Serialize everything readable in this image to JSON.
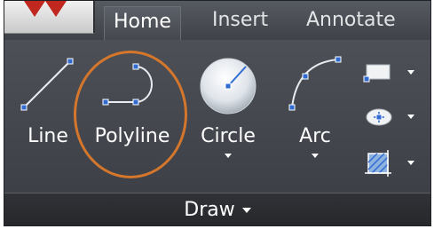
{
  "tabs": [
    {
      "label": "Home",
      "active": true
    },
    {
      "label": "Insert",
      "active": false
    },
    {
      "label": "Annotate",
      "active": false
    }
  ],
  "tools": {
    "line": "Line",
    "polyline": "Polyline",
    "circle": "Circle",
    "arc": "Arc"
  },
  "panel": {
    "title": "Draw"
  },
  "colors": {
    "highlight": "#d4772c",
    "accent": "#ffffff",
    "background": "#3b3e44"
  },
  "icons": [
    "app-logo-icon",
    "line-icon",
    "polyline-icon",
    "circle-icon",
    "arc-icon",
    "rectangle-icon",
    "ellipse-icon",
    "hatch-icon"
  ]
}
